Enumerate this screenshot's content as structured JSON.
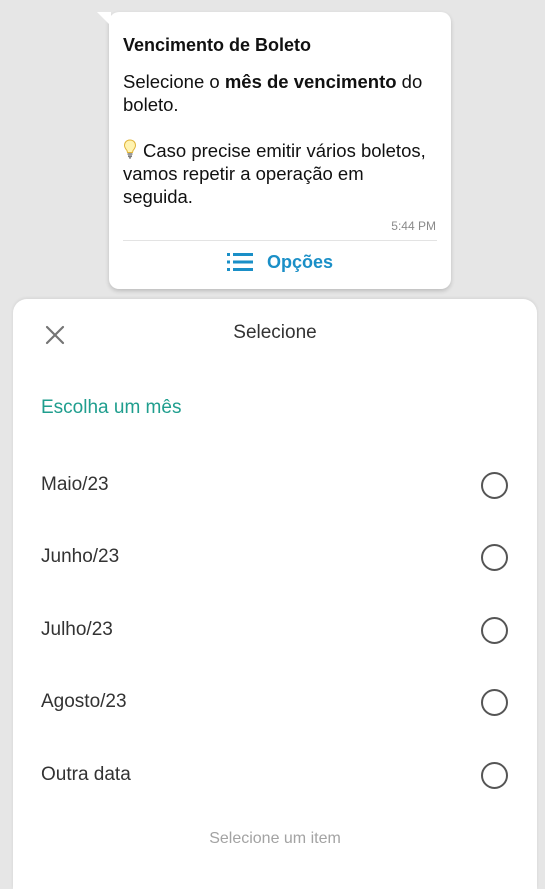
{
  "message": {
    "title": "Vencimento de Boleto",
    "line1_pre": "Selecione o ",
    "line1_bold": "mês de vencimento",
    "line1_post": " do boleto.",
    "line2": "Caso precise emitir vários boletos, vamos repetir a operação em seguida.",
    "time": "5:44 PM",
    "options_label": "Opções"
  },
  "sheet": {
    "title": "Selecione",
    "section_label": "Escolha um mês",
    "options": [
      {
        "label": "Maio/23",
        "selected": false
      },
      {
        "label": "Junho/23",
        "selected": false
      },
      {
        "label": "Julho/23",
        "selected": false
      },
      {
        "label": "Agosto/23",
        "selected": false
      },
      {
        "label": "Outra data",
        "selected": false
      }
    ],
    "footer": "Selecione um item"
  },
  "colors": {
    "accent_blue": "#1a8fc7",
    "accent_teal": "#1f9e8e",
    "background": "#e6e6e6"
  },
  "icons": {
    "close": "close-icon",
    "options": "list-icon",
    "bulb": "lightbulb-icon"
  }
}
